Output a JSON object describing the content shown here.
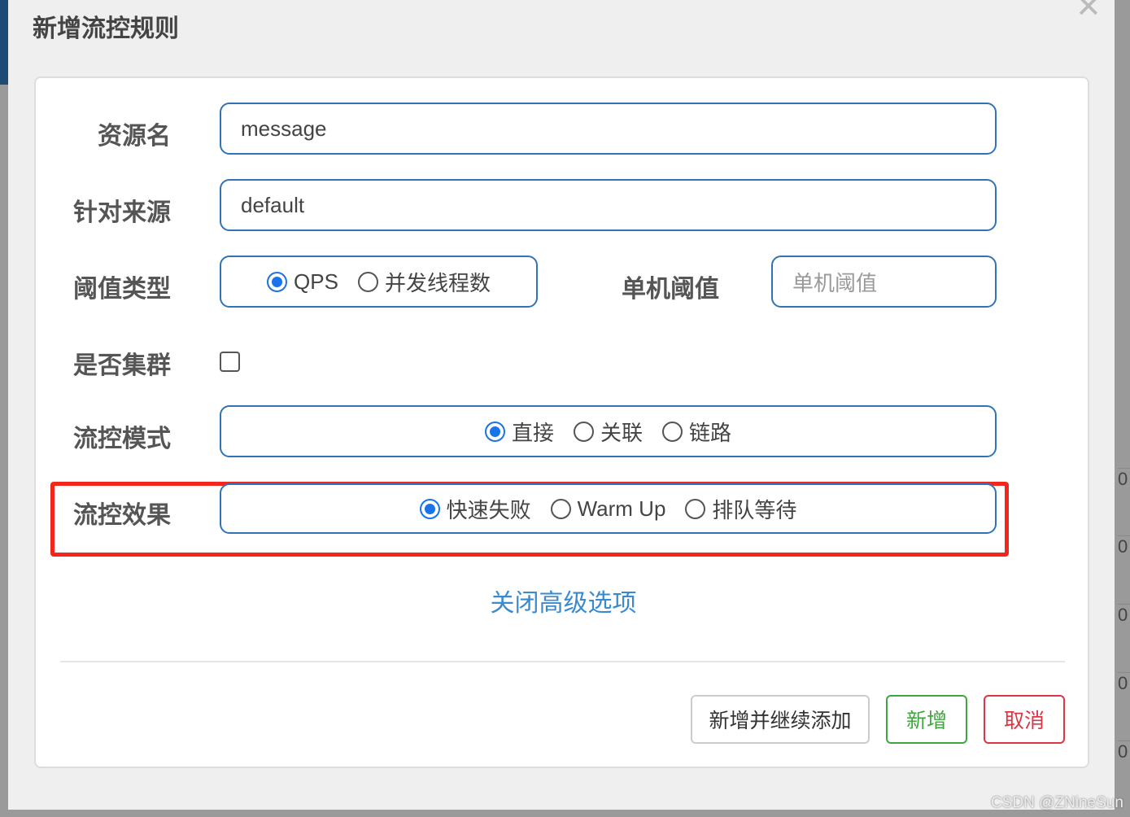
{
  "dialog": {
    "title": "新增流控规则",
    "close_icon": "close-icon"
  },
  "form": {
    "resource": {
      "label": "资源名",
      "value": "message"
    },
    "limit_app": {
      "label": "针对来源",
      "value": "default"
    },
    "grade": {
      "label": "阈值类型",
      "options": [
        "QPS",
        "并发线程数"
      ],
      "selected": "QPS"
    },
    "count": {
      "label": "单机阈值",
      "placeholder": "单机阈值"
    },
    "cluster": {
      "label": "是否集群",
      "checked": false
    },
    "strategy": {
      "label": "流控模式",
      "options": [
        "直接",
        "关联",
        "链路"
      ],
      "selected": "直接"
    },
    "control_behavior": {
      "label": "流控效果",
      "options": [
        "快速失败",
        "Warm Up",
        "排队等待"
      ],
      "selected": "快速失败"
    }
  },
  "advanced_link": "关闭高级选项",
  "buttons": {
    "add_continue": "新增并继续添加",
    "add": "新增",
    "cancel": "取消"
  },
  "colors": {
    "accent": "#2f74b5",
    "radio": "#1a73e8",
    "highlight": "#f2261c",
    "add": "#3fa63f",
    "cancel": "#dc3545"
  },
  "background": {
    "cells": [
      "0",
      "0",
      "0",
      "0",
      "0"
    ]
  },
  "watermark": "CSDN @ZNineSun"
}
